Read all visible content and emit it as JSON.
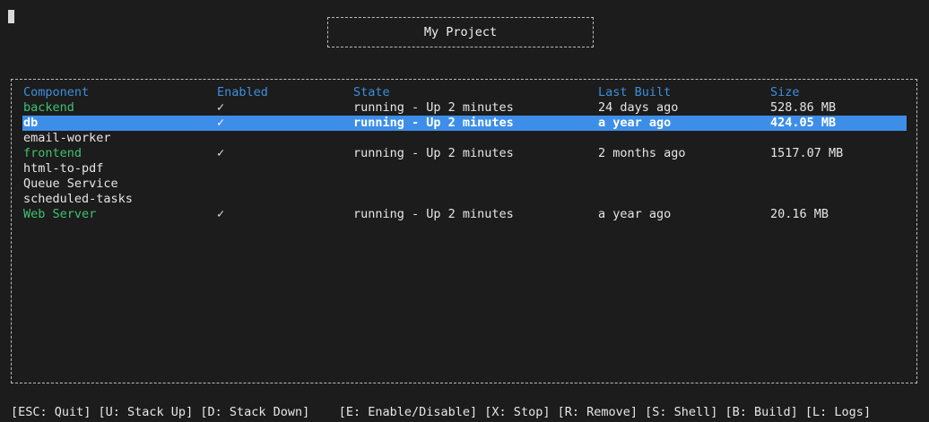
{
  "app": {
    "title": "My Project"
  },
  "table": {
    "headers": {
      "component": "Component",
      "enabled": "Enabled",
      "state": "State",
      "last_built": "Last Built",
      "size": "Size"
    },
    "rows": [
      {
        "name": "backend",
        "enabled": "✓",
        "state": "running - Up 2 minutes",
        "last_built": "24 days ago",
        "size": "528.86 MB",
        "running": true,
        "selected": false
      },
      {
        "name": "db",
        "enabled": "✓",
        "state": "running - Up 2 minutes",
        "last_built": "a year ago",
        "size": "424.05 MB",
        "running": true,
        "selected": true
      },
      {
        "name": "email-worker",
        "enabled": "",
        "state": "",
        "last_built": "",
        "size": "",
        "running": false,
        "selected": false
      },
      {
        "name": "frontend",
        "enabled": "✓",
        "state": "running - Up 2 minutes",
        "last_built": "2 months ago",
        "size": "1517.07 MB",
        "running": true,
        "selected": false
      },
      {
        "name": "html-to-pdf",
        "enabled": "",
        "state": "",
        "last_built": "",
        "size": "",
        "running": false,
        "selected": false
      },
      {
        "name": "Queue Service",
        "enabled": "",
        "state": "",
        "last_built": "",
        "size": "",
        "running": false,
        "selected": false
      },
      {
        "name": "scheduled-tasks",
        "enabled": "",
        "state": "",
        "last_built": "",
        "size": "",
        "running": false,
        "selected": false
      },
      {
        "name": "Web Server",
        "enabled": "✓",
        "state": "running - Up 2 minutes",
        "last_built": "a year ago",
        "size": "20.16 MB",
        "running": true,
        "selected": false
      }
    ]
  },
  "footer": {
    "text": "[ESC: Quit] [U: Stack Up] [D: Stack Down]    [E: Enable/Disable] [X: Stop] [R: Remove] [S: Shell] [B: Build] [L: Logs]"
  },
  "colors": {
    "background": "#1c1c1c",
    "header": "#3d8edb",
    "running": "#3ec271",
    "selection": "#3d8ee8"
  }
}
